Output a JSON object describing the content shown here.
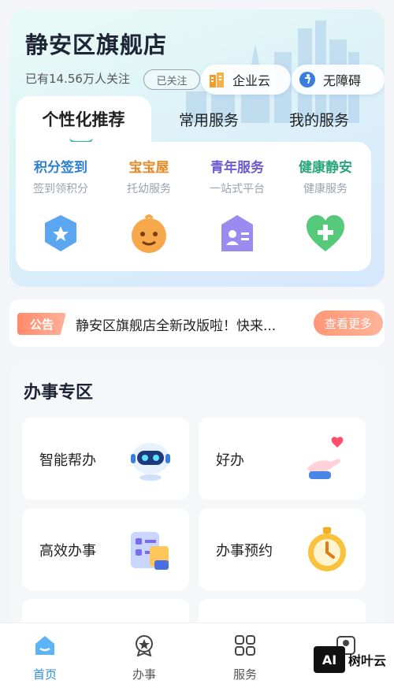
{
  "store": {
    "title": "静安区旗舰店",
    "followers": "已有14.56万人关注",
    "follow_state": "已关注",
    "enterprise_label": "企业云",
    "accessibility_label": "无障碍"
  },
  "tabs": [
    {
      "label": "个性化推荐",
      "active": true
    },
    {
      "label": "常用服务",
      "active": false
    },
    {
      "label": "我的服务",
      "active": false
    }
  ],
  "services": [
    {
      "name": "积分签到",
      "sub": "签到领积分",
      "color": "#2f7fcf",
      "icon": "star-shield-icon"
    },
    {
      "name": "宝宝屋",
      "sub": "托幼服务",
      "color": "#e28a2a",
      "icon": "baby-face-icon"
    },
    {
      "name": "青年服务",
      "sub": "一站式平台",
      "color": "#6c5ad6",
      "icon": "id-card-icon"
    },
    {
      "name": "健康静安",
      "sub": "健康服务",
      "color": "#2aa77a",
      "icon": "heart-plus-icon"
    }
  ],
  "notice": {
    "tag": "公告",
    "text": "静安区旗舰店全新改版啦！快来...",
    "button": "查看更多"
  },
  "section": {
    "title": "办事专区",
    "cards": [
      {
        "label": "智能帮办",
        "icon": "robot-icon"
      },
      {
        "label": "好办",
        "icon": "hand-heart-icon"
      },
      {
        "label": "高效办事",
        "icon": "task-board-icon"
      },
      {
        "label": "办事预约",
        "icon": "stopwatch-icon"
      }
    ]
  },
  "tabbar": [
    {
      "label": "首页",
      "icon": "home-icon",
      "active": true
    },
    {
      "label": "办事",
      "icon": "badge-icon",
      "active": false
    },
    {
      "label": "服务",
      "icon": "grid-icon",
      "active": false
    },
    {
      "label": "",
      "icon": "profile-icon",
      "active": false
    }
  ],
  "watermark": {
    "box": "AI",
    "text": "树叶云"
  },
  "colors": {
    "accent": "#2a8fd6",
    "teal": "#2bb3a5",
    "notice": "#ff8a6b"
  }
}
